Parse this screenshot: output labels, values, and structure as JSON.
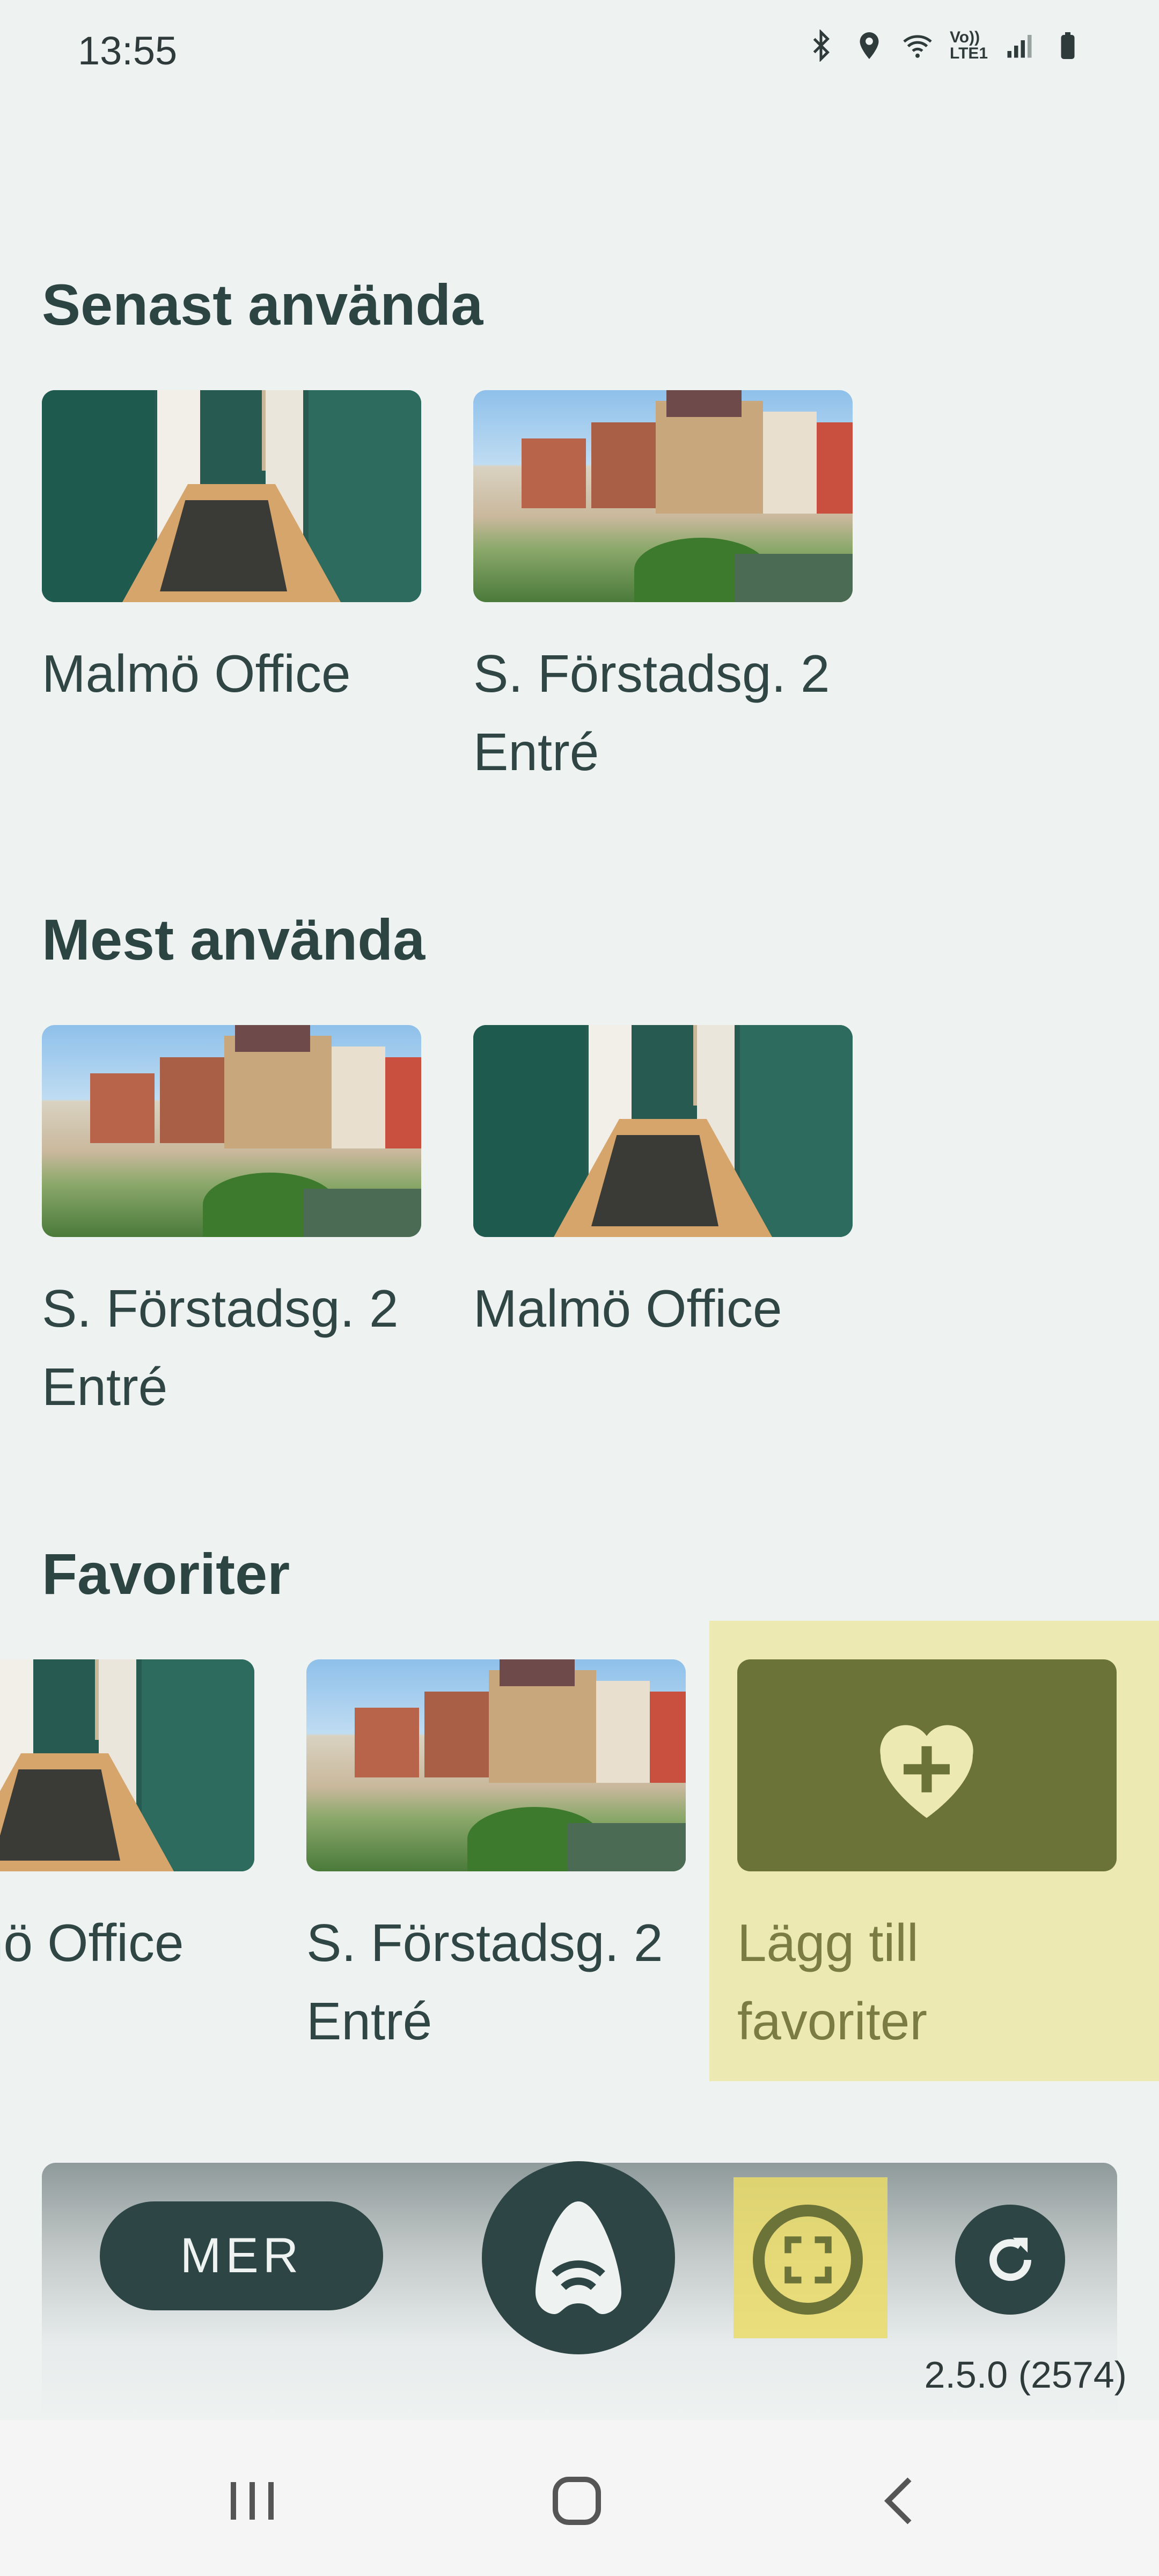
{
  "status": {
    "time": "13:55",
    "icons": [
      "bluetooth-icon",
      "location-icon",
      "wifi-icon",
      "volte-icon",
      "signal-icon",
      "battery-icon"
    ],
    "volte_text": "Vo)) LTE1"
  },
  "sections": {
    "recent": {
      "title": "Senast använda",
      "items": [
        {
          "label": "Malmö Office",
          "image": "hallway"
        },
        {
          "label": "S. Förstadsg. 2 Entré",
          "image": "city"
        }
      ]
    },
    "most": {
      "title": "Mest använda",
      "items": [
        {
          "label": "S. Förstadsg. 2 Entré",
          "image": "city"
        },
        {
          "label": "Malmö Office",
          "image": "hallway"
        }
      ]
    },
    "favorites": {
      "title": "Favoriter",
      "items": [
        {
          "label": "Malmö Office",
          "image": "hallway"
        },
        {
          "label": "S. Förstadsg. 2 Entré",
          "image": "city"
        }
      ],
      "add_label": "Lägg till favoriter"
    }
  },
  "bottom": {
    "more_label": "MER",
    "version": "2.5.0 (2574)"
  },
  "colors": {
    "background": "#eef2f1",
    "primary": "#2d4645",
    "olive": "#6b7339",
    "highlight": "#ece9b3"
  }
}
